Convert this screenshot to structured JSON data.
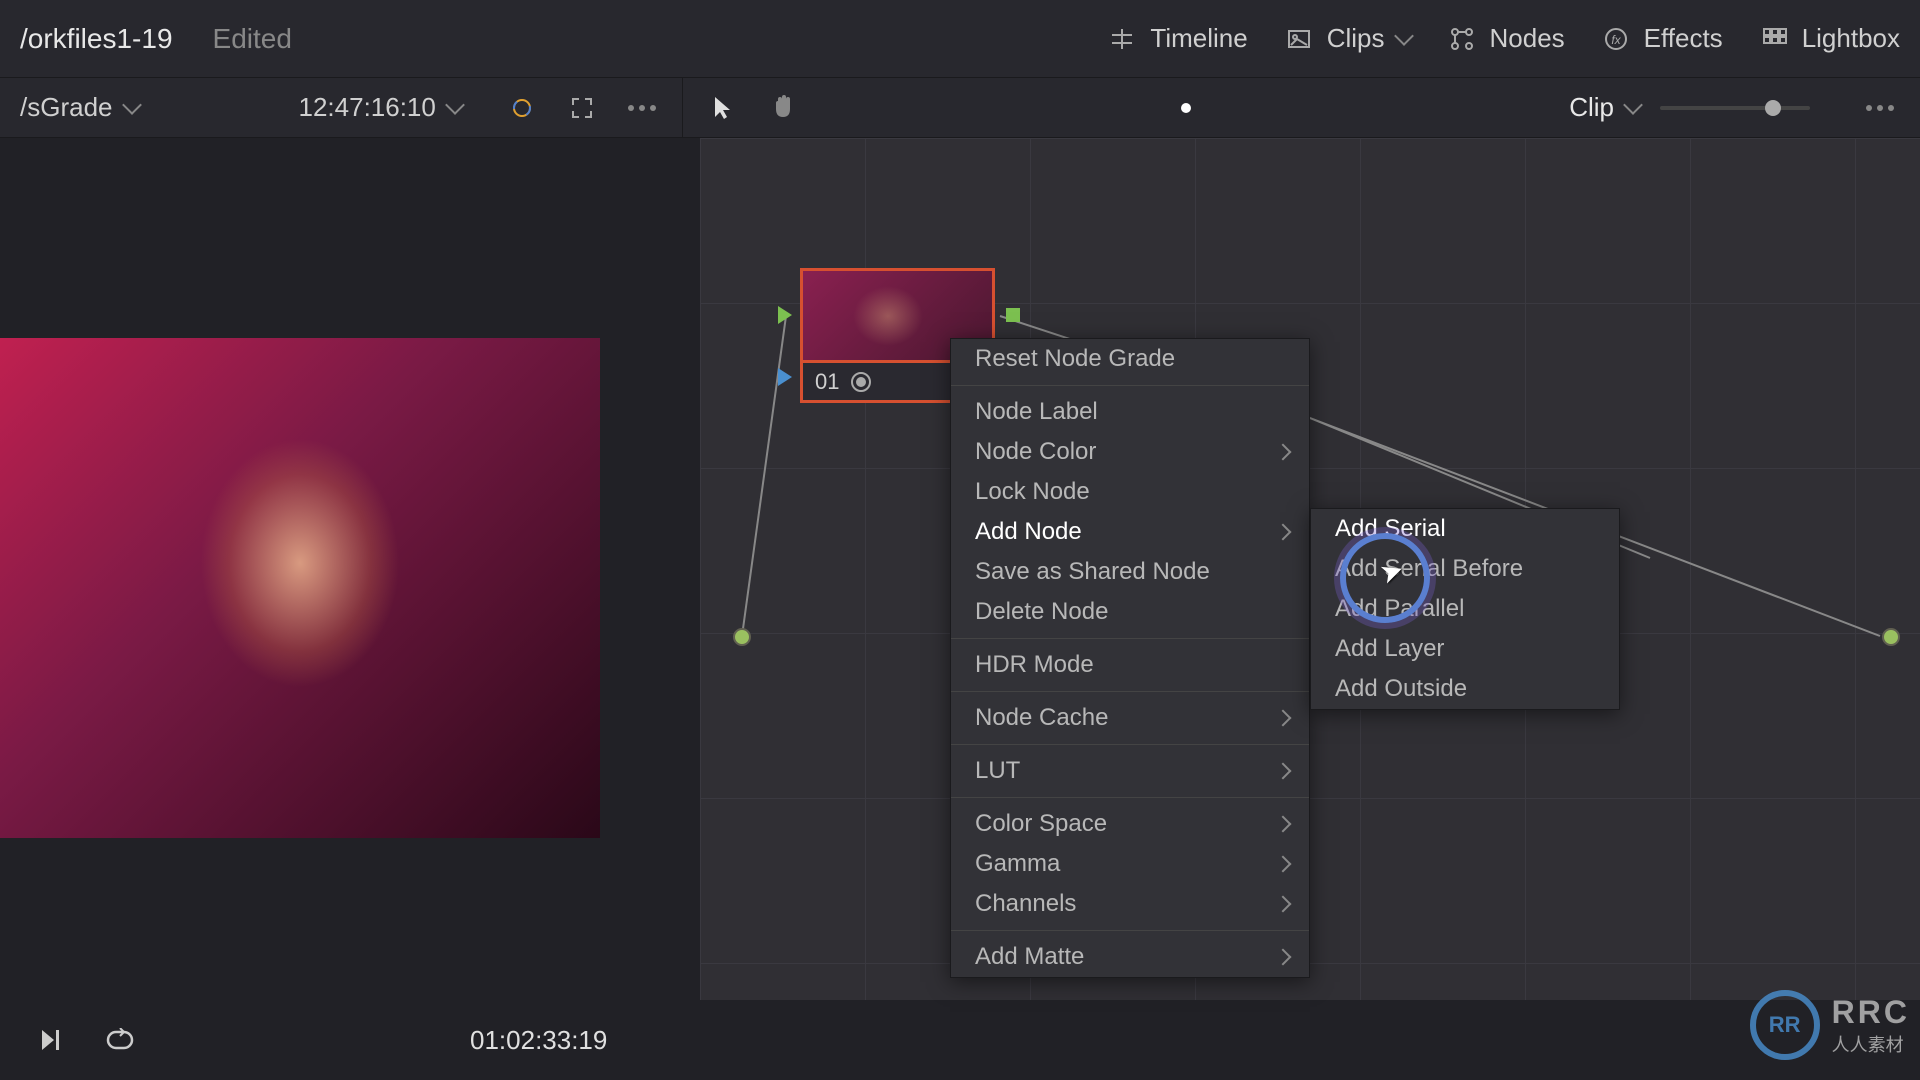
{
  "header": {
    "project_name": "/orkfiles1-19",
    "edit_status": "Edited",
    "tools": {
      "timeline": "Timeline",
      "clips": "Clips",
      "nodes": "Nodes",
      "effects": "Effects",
      "lightbox": "Lightbox"
    }
  },
  "second_bar": {
    "grade_name": "/sGrade",
    "viewer_timecode": "12:47:16:10",
    "clip_dropdown": "Clip"
  },
  "node": {
    "number": "01"
  },
  "context_menu": {
    "reset_node": "Reset Node Grade",
    "node_label": "Node Label",
    "node_color": "Node Color",
    "lock_node": "Lock Node",
    "add_node": "Add Node",
    "save_shared": "Save as Shared Node",
    "delete_node": "Delete Node",
    "hdr_mode": "HDR Mode",
    "node_cache": "Node Cache",
    "lut": "LUT",
    "color_space": "Color Space",
    "gamma": "Gamma",
    "channels": "Channels",
    "add_matte": "Add Matte"
  },
  "submenu": {
    "add_serial": "Add Serial",
    "add_serial_before": "Add Serial Before",
    "add_parallel": "Add Parallel",
    "add_layer": "Add Layer",
    "add_outside": "Add Outside"
  },
  "transport": {
    "timecode": "01:02:33:19"
  },
  "watermark": {
    "logo_text": "RR",
    "main": "RRC",
    "sub": "人人素材"
  }
}
